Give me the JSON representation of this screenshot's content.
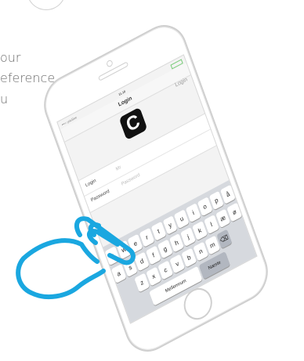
{
  "side_text": {
    "line1": "our",
    "line2": "eference",
    "line3": "u"
  },
  "status_bar": {
    "carrier": "•••○ youSee",
    "time": "11.10"
  },
  "nav": {
    "title": "Login",
    "action": "Login"
  },
  "logo": {
    "letter": "C"
  },
  "form": {
    "rows": [
      {
        "label": "Login",
        "value": "Mr"
      },
      {
        "label": "Password",
        "value": "Password"
      }
    ]
  },
  "keyboard": {
    "row1": [
      "q",
      "w",
      "e",
      "r",
      "t",
      "y",
      "u",
      "i",
      "o",
      "p",
      "å"
    ],
    "row2": [
      "a",
      "s",
      "d",
      "f",
      "g",
      "h",
      "j",
      "k",
      "l",
      "æ",
      "ø"
    ],
    "row3": [
      "z",
      "x",
      "c",
      "v",
      "b",
      "n",
      "m"
    ],
    "space_label": "Mellemrum",
    "return_label": "Næste"
  },
  "colors": {
    "hand": "#1aa7e0",
    "phone_outline": "#cfcfcf"
  },
  "icons": {
    "home": "home-button",
    "delete": "delete-key-icon",
    "hand": "tap-hand-icon"
  }
}
